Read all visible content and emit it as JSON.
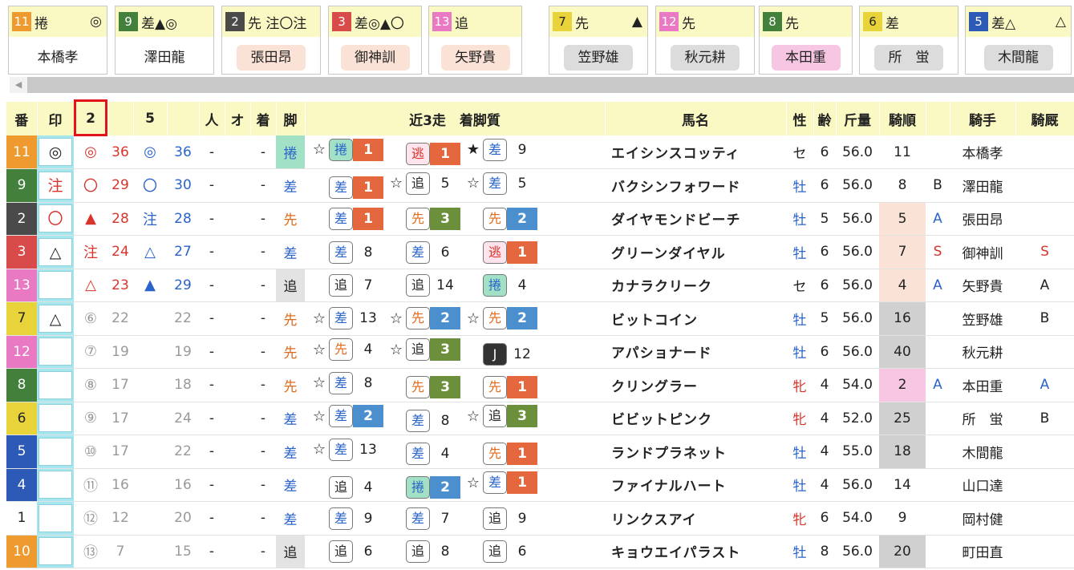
{
  "colors": {
    "waku1": "#ffffff",
    "waku2": "#4a4a4a",
    "waku3": "#d94b4b",
    "waku4": "#2c5ab6",
    "waku5": "#e8d33b",
    "waku6": "#43803c",
    "waku7": "#ef9a2f",
    "waku8": "#e879c2",
    "header_bg": "#fbf9c3",
    "highlight": "#e1141b"
  },
  "cards": [
    {
      "num": "11",
      "marks": "捲",
      "right": "◎",
      "jockey": "本橋孝",
      "num_bg": "#ef9a2f",
      "j_bg": "#ffffff"
    },
    {
      "num": "9",
      "marks": "差▲◎",
      "right": "",
      "jockey": "澤田龍",
      "num_bg": "#43803c",
      "j_bg": "#ffffff"
    },
    {
      "num": "2",
      "marks": "先 注〇注",
      "right": "",
      "jockey": "張田昂",
      "num_bg": "#4a4a4a",
      "j_bg": "#fbe2d6"
    },
    {
      "num": "3",
      "marks": "差◎▲〇",
      "right": "",
      "jockey": "御神訓",
      "num_bg": "#d94b4b",
      "j_bg": "#fbe2d6"
    },
    {
      "num": "13",
      "marks": "追",
      "right": "",
      "jockey": "矢野貴",
      "num_bg": "#e879c2",
      "j_bg": "#fbe2d6"
    },
    {
      "num": "7",
      "marks": "先",
      "right": "▲",
      "jockey": "笠野雄",
      "num_bg": "#e8d33b",
      "j_bg": "#dcdcdc"
    },
    {
      "num": "12",
      "marks": "先",
      "right": "",
      "jockey": "秋元耕",
      "num_bg": "#e879c2",
      "j_bg": "#dcdcdc"
    },
    {
      "num": "8",
      "marks": "先",
      "right": "",
      "jockey": "本田重",
      "num_bg": "#43803c",
      "j_bg": "#f6c6e3"
    },
    {
      "num": "6",
      "marks": "差",
      "right": "",
      "jockey": "所　蛍",
      "num_bg": "#e8d33b",
      "j_bg": "#dcdcdc"
    },
    {
      "num": "5",
      "marks": "差△",
      "right": "△",
      "jockey": "木間龍",
      "num_bg": "#2c5ab6",
      "j_bg": "#dcdcdc"
    }
  ],
  "headers": [
    "番",
    "印",
    "2",
    "",
    "5",
    "",
    "人",
    "オ",
    "着",
    "脚",
    "近3走　着脚質",
    "馬名",
    "性",
    "齢",
    "斤量",
    "騎順",
    "",
    "騎手",
    "騎厩"
  ],
  "rows": [
    {
      "num": "11",
      "waku": "#ef9a2f",
      "shirushi": "◎",
      "shi_col": "#222",
      "m2": "◎",
      "m2c": "red",
      "s2": "36",
      "m5": "◎",
      "m5c": "blue",
      "s5": "36",
      "ninki": "-",
      "odds": "",
      "chaku": "-",
      "leg": "捲",
      "leg_bg": "#a3e1c6",
      "leg_c": "#2a63c9",
      "recent": [
        {
          "star": "☆",
          "leg": "捲",
          "lc": "#2a63c9",
          "lbg": "#a3e1c6",
          "fin": "1",
          "fbg": "#e5673e"
        },
        {
          "star": "",
          "leg": "逃",
          "lc": "#d9342b",
          "lbg": "#fde3ec",
          "fin": "1",
          "fbg": "#e5673e"
        },
        {
          "star": "★",
          "leg": "差",
          "lc": "#2a63c9",
          "lbg": "#fff",
          "fin": "9",
          "fbg": ""
        }
      ],
      "horse": "エイシンスコッティ",
      "sex": "セ",
      "sexc": "#222",
      "age": "6",
      "kin": "56.0",
      "kijun": "11",
      "kbg": "",
      "kmark": "",
      "kmc": "",
      "jockey": "本橋孝",
      "stable": "",
      "stc": ""
    },
    {
      "num": "9",
      "waku": "#43803c",
      "shirushi": "注",
      "shi_col": "#d9342b",
      "m2": "〇",
      "m2c": "red",
      "s2": "29",
      "m5": "〇",
      "m5c": "blue",
      "s5": "30",
      "ninki": "-",
      "odds": "",
      "chaku": "-",
      "leg": "差",
      "leg_bg": "",
      "leg_c": "#2a63c9",
      "recent": [
        {
          "star": "",
          "leg": "差",
          "lc": "#2a63c9",
          "lbg": "#fff",
          "fin": "1",
          "fbg": "#e5673e"
        },
        {
          "star": "☆",
          "leg": "追",
          "lc": "#222",
          "lbg": "#fff",
          "fin": "5",
          "fbg": ""
        },
        {
          "star": "☆",
          "leg": "差",
          "lc": "#2a63c9",
          "lbg": "#fff",
          "fin": "5",
          "fbg": ""
        }
      ],
      "horse": "バクシンフォワード",
      "sex": "牡",
      "sexc": "#2a63c9",
      "age": "6",
      "kin": "56.0",
      "kijun": "8",
      "kbg": "",
      "kmark": "B",
      "kmc": "#222",
      "jockey": "澤田龍",
      "stable": "",
      "stc": ""
    },
    {
      "num": "2",
      "waku": "#4a4a4a",
      "shirushi": "〇",
      "shi_col": "#d9342b",
      "m2": "▲",
      "m2c": "red",
      "s2": "28",
      "m5": "注",
      "m5c": "blue",
      "s5": "28",
      "ninki": "-",
      "odds": "",
      "chaku": "-",
      "leg": "先",
      "leg_bg": "",
      "leg_c": "#e06a1b",
      "recent": [
        {
          "star": "",
          "leg": "差",
          "lc": "#2a63c9",
          "lbg": "#fff",
          "fin": "1",
          "fbg": "#e5673e"
        },
        {
          "star": "",
          "leg": "先",
          "lc": "#e06a1b",
          "lbg": "#fff",
          "fin": "3",
          "fbg": "#6b8f3a"
        },
        {
          "star": "",
          "leg": "先",
          "lc": "#e06a1b",
          "lbg": "#fff",
          "fin": "2",
          "fbg": "#4b8fce"
        }
      ],
      "horse": "ダイヤモンドビーチ",
      "sex": "牡",
      "sexc": "#2a63c9",
      "age": "5",
      "kin": "56.0",
      "kijun": "5",
      "kbg": "#fbe2d6",
      "kmark": "A",
      "kmc": "#2a63c9",
      "jockey": "張田昂",
      "stable": "",
      "stc": ""
    },
    {
      "num": "3",
      "waku": "#d94b4b",
      "shirushi": "△",
      "shi_col": "#222",
      "m2": "注",
      "m2c": "red",
      "s2": "24",
      "m5": "△",
      "m5c": "blue",
      "s5": "27",
      "ninki": "-",
      "odds": "",
      "chaku": "-",
      "leg": "差",
      "leg_bg": "",
      "leg_c": "#2a63c9",
      "recent": [
        {
          "star": "",
          "leg": "差",
          "lc": "#2a63c9",
          "lbg": "#fff",
          "fin": "8",
          "fbg": ""
        },
        {
          "star": "",
          "leg": "差",
          "lc": "#2a63c9",
          "lbg": "#fff",
          "fin": "6",
          "fbg": ""
        },
        {
          "star": "",
          "leg": "逃",
          "lc": "#d9342b",
          "lbg": "#fde3ec",
          "fin": "1",
          "fbg": "#e5673e"
        }
      ],
      "horse": "グリーンダイヤル",
      "sex": "牡",
      "sexc": "#2a63c9",
      "age": "6",
      "kin": "56.0",
      "kijun": "7",
      "kbg": "#fbe2d6",
      "kmark": "S",
      "kmc": "#d9342b",
      "jockey": "御神訓",
      "stable": "S",
      "stc": "#d9342b"
    },
    {
      "num": "13",
      "waku": "#e879c2",
      "shirushi": "",
      "shi_col": "#222",
      "m2": "△",
      "m2c": "red",
      "s2": "23",
      "m5": "▲",
      "m5c": "blue",
      "s5": "29",
      "ninki": "-",
      "odds": "",
      "chaku": "-",
      "leg": "追",
      "leg_bg": "#e3e3e3",
      "leg_c": "#222",
      "recent": [
        {
          "star": "",
          "leg": "追",
          "lc": "#222",
          "lbg": "#fff",
          "fin": "7",
          "fbg": ""
        },
        {
          "star": "",
          "leg": "追",
          "lc": "#222",
          "lbg": "#fff",
          "fin": "14",
          "fbg": ""
        },
        {
          "star": "",
          "leg": "捲",
          "lc": "#2a63c9",
          "lbg": "#a3e1c6",
          "fin": "4",
          "fbg": ""
        }
      ],
      "horse": "カナラクリーク",
      "sex": "セ",
      "sexc": "#222",
      "age": "6",
      "kin": "56.0",
      "kijun": "4",
      "kbg": "#fbe2d6",
      "kmark": "A",
      "kmc": "#2a63c9",
      "jockey": "矢野貴",
      "stable": "A",
      "stc": "#222"
    },
    {
      "num": "7",
      "waku": "#e8d33b",
      "shirushi": "△",
      "shi_col": "#222",
      "m2": "⑥",
      "m2c": "gray",
      "s2": "22",
      "m5": "",
      "m5c": "gray",
      "s5": "22",
      "ninki": "-",
      "odds": "",
      "chaku": "-",
      "leg": "先",
      "leg_bg": "",
      "leg_c": "#e06a1b",
      "recent": [
        {
          "star": "☆",
          "leg": "差",
          "lc": "#2a63c9",
          "lbg": "#fff",
          "fin": "13",
          "fbg": ""
        },
        {
          "star": "☆",
          "leg": "先",
          "lc": "#e06a1b",
          "lbg": "#fff",
          "fin": "2",
          "fbg": "#4b8fce"
        },
        {
          "star": "☆",
          "leg": "先",
          "lc": "#e06a1b",
          "lbg": "#fff",
          "fin": "2",
          "fbg": "#4b8fce"
        }
      ],
      "horse": "ビットコイン",
      "sex": "牡",
      "sexc": "#2a63c9",
      "age": "5",
      "kin": "56.0",
      "kijun": "16",
      "kbg": "#d0d0d0",
      "kmark": "",
      "kmc": "",
      "jockey": "笠野雄",
      "stable": "B",
      "stc": "#222"
    },
    {
      "num": "12",
      "waku": "#e879c2",
      "shirushi": "",
      "shi_col": "#222",
      "m2": "⑦",
      "m2c": "gray",
      "s2": "19",
      "m5": "",
      "m5c": "gray",
      "s5": "19",
      "ninki": "-",
      "odds": "",
      "chaku": "-",
      "leg": "先",
      "leg_bg": "",
      "leg_c": "#e06a1b",
      "recent": [
        {
          "star": "☆",
          "leg": "先",
          "lc": "#e06a1b",
          "lbg": "#fff",
          "fin": "4",
          "fbg": ""
        },
        {
          "star": "☆",
          "leg": "追",
          "lc": "#222",
          "lbg": "#fff",
          "fin": "3",
          "fbg": "#6b8f3a"
        },
        {
          "star": "",
          "leg": "J",
          "lc": "#fff",
          "lbg": "#333",
          "fin": "12",
          "fbg": ""
        }
      ],
      "horse": "アパショナード",
      "sex": "牡",
      "sexc": "#2a63c9",
      "age": "6",
      "kin": "56.0",
      "kijun": "40",
      "kbg": "#d0d0d0",
      "kmark": "",
      "kmc": "",
      "jockey": "秋元耕",
      "stable": "",
      "stc": ""
    },
    {
      "num": "8",
      "waku": "#43803c",
      "shirushi": "",
      "shi_col": "#222",
      "m2": "⑧",
      "m2c": "gray",
      "s2": "17",
      "m5": "",
      "m5c": "gray",
      "s5": "18",
      "ninki": "-",
      "odds": "",
      "chaku": "-",
      "leg": "先",
      "leg_bg": "",
      "leg_c": "#e06a1b",
      "recent": [
        {
          "star": "☆",
          "leg": "差",
          "lc": "#2a63c9",
          "lbg": "#fff",
          "fin": "8",
          "fbg": ""
        },
        {
          "star": "",
          "leg": "先",
          "lc": "#e06a1b",
          "lbg": "#fff",
          "fin": "3",
          "fbg": "#6b8f3a"
        },
        {
          "star": "",
          "leg": "先",
          "lc": "#e06a1b",
          "lbg": "#fff",
          "fin": "1",
          "fbg": "#e5673e"
        }
      ],
      "horse": "クリングラー",
      "sex": "牝",
      "sexc": "#d9342b",
      "age": "4",
      "kin": "54.0",
      "kijun": "2",
      "kbg": "#f6c6e3",
      "kmark": "A",
      "kmc": "#2a63c9",
      "jockey": "本田重",
      "stable": "A",
      "stc": "#2a63c9"
    },
    {
      "num": "6",
      "waku": "#e8d33b",
      "shirushi": "",
      "shi_col": "#222",
      "m2": "⑨",
      "m2c": "gray",
      "s2": "17",
      "m5": "",
      "m5c": "gray",
      "s5": "24",
      "ninki": "-",
      "odds": "",
      "chaku": "-",
      "leg": "差",
      "leg_bg": "",
      "leg_c": "#2a63c9",
      "recent": [
        {
          "star": "☆",
          "leg": "差",
          "lc": "#2a63c9",
          "lbg": "#fff",
          "fin": "2",
          "fbg": "#4b8fce"
        },
        {
          "star": "",
          "leg": "差",
          "lc": "#2a63c9",
          "lbg": "#fff",
          "fin": "8",
          "fbg": ""
        },
        {
          "star": "☆",
          "leg": "追",
          "lc": "#222",
          "lbg": "#fff",
          "fin": "3",
          "fbg": "#6b8f3a"
        }
      ],
      "horse": "ビビットピンク",
      "sex": "牝",
      "sexc": "#d9342b",
      "age": "4",
      "kin": "52.0",
      "kijun": "25",
      "kbg": "#d0d0d0",
      "kmark": "",
      "kmc": "",
      "jockey": "所　蛍",
      "stable": "B",
      "stc": "#222"
    },
    {
      "num": "5",
      "waku": "#2c5ab6",
      "shirushi": "",
      "shi_col": "#222",
      "m2": "⑩",
      "m2c": "gray",
      "s2": "17",
      "m5": "",
      "m5c": "gray",
      "s5": "22",
      "ninki": "-",
      "odds": "",
      "chaku": "-",
      "leg": "差",
      "leg_bg": "",
      "leg_c": "#2a63c9",
      "recent": [
        {
          "star": "☆",
          "leg": "差",
          "lc": "#2a63c9",
          "lbg": "#fff",
          "fin": "13",
          "fbg": ""
        },
        {
          "star": "",
          "leg": "差",
          "lc": "#2a63c9",
          "lbg": "#fff",
          "fin": "4",
          "fbg": ""
        },
        {
          "star": "",
          "leg": "先",
          "lc": "#e06a1b",
          "lbg": "#fff",
          "fin": "1",
          "fbg": "#e5673e"
        }
      ],
      "horse": "ランドプラネット",
      "sex": "牡",
      "sexc": "#2a63c9",
      "age": "4",
      "kin": "55.0",
      "kijun": "18",
      "kbg": "#d0d0d0",
      "kmark": "",
      "kmc": "",
      "jockey": "木間龍",
      "stable": "",
      "stc": ""
    },
    {
      "num": "4",
      "waku": "#2c5ab6",
      "shirushi": "",
      "shi_col": "#222",
      "m2": "⑪",
      "m2c": "gray",
      "s2": "16",
      "m5": "",
      "m5c": "gray",
      "s5": "16",
      "ninki": "-",
      "odds": "",
      "chaku": "-",
      "leg": "差",
      "leg_bg": "",
      "leg_c": "#2a63c9",
      "recent": [
        {
          "star": "",
          "leg": "追",
          "lc": "#222",
          "lbg": "#fff",
          "fin": "4",
          "fbg": ""
        },
        {
          "star": "",
          "leg": "捲",
          "lc": "#2a63c9",
          "lbg": "#a3e1c6",
          "fin": "2",
          "fbg": "#4b8fce"
        },
        {
          "star": "☆",
          "leg": "差",
          "lc": "#2a63c9",
          "lbg": "#fff",
          "fin": "1",
          "fbg": "#e5673e"
        }
      ],
      "horse": "ファイナルハート",
      "sex": "牡",
      "sexc": "#2a63c9",
      "age": "4",
      "kin": "56.0",
      "kijun": "14",
      "kbg": "",
      "kmark": "",
      "kmc": "",
      "jockey": "山口達",
      "stable": "",
      "stc": ""
    },
    {
      "num": "1",
      "waku": "#ffffff",
      "shirushi": "",
      "shi_col": "#222",
      "m2": "⑫",
      "m2c": "gray",
      "s2": "12",
      "m5": "",
      "m5c": "gray",
      "s5": "20",
      "ninki": "-",
      "odds": "",
      "chaku": "-",
      "leg": "差",
      "leg_bg": "",
      "leg_c": "#2a63c9",
      "recent": [
        {
          "star": "",
          "leg": "差",
          "lc": "#2a63c9",
          "lbg": "#fff",
          "fin": "9",
          "fbg": ""
        },
        {
          "star": "",
          "leg": "差",
          "lc": "#2a63c9",
          "lbg": "#fff",
          "fin": "7",
          "fbg": ""
        },
        {
          "star": "",
          "leg": "追",
          "lc": "#222",
          "lbg": "#fff",
          "fin": "9",
          "fbg": ""
        }
      ],
      "horse": "リンクスアイ",
      "sex": "牝",
      "sexc": "#d9342b",
      "age": "6",
      "kin": "54.0",
      "kijun": "9",
      "kbg": "",
      "kmark": "",
      "kmc": "",
      "jockey": "岡村健",
      "stable": "",
      "stc": ""
    },
    {
      "num": "10",
      "waku": "#ef9a2f",
      "shirushi": "",
      "shi_col": "#222",
      "m2": "⑬",
      "m2c": "gray",
      "s2": "7",
      "m5": "",
      "m5c": "gray",
      "s5": "15",
      "ninki": "-",
      "odds": "",
      "chaku": "-",
      "leg": "追",
      "leg_bg": "#e3e3e3",
      "leg_c": "#222",
      "recent": [
        {
          "star": "",
          "leg": "追",
          "lc": "#222",
          "lbg": "#fff",
          "fin": "6",
          "fbg": ""
        },
        {
          "star": "",
          "leg": "追",
          "lc": "#222",
          "lbg": "#fff",
          "fin": "8",
          "fbg": ""
        },
        {
          "star": "",
          "leg": "追",
          "lc": "#222",
          "lbg": "#fff",
          "fin": "6",
          "fbg": ""
        }
      ],
      "horse": "キョウエイパラスト",
      "sex": "牡",
      "sexc": "#2a63c9",
      "age": "8",
      "kin": "56.0",
      "kijun": "20",
      "kbg": "#d0d0d0",
      "kmark": "",
      "kmc": "",
      "jockey": "町田直",
      "stable": "",
      "stc": ""
    }
  ]
}
